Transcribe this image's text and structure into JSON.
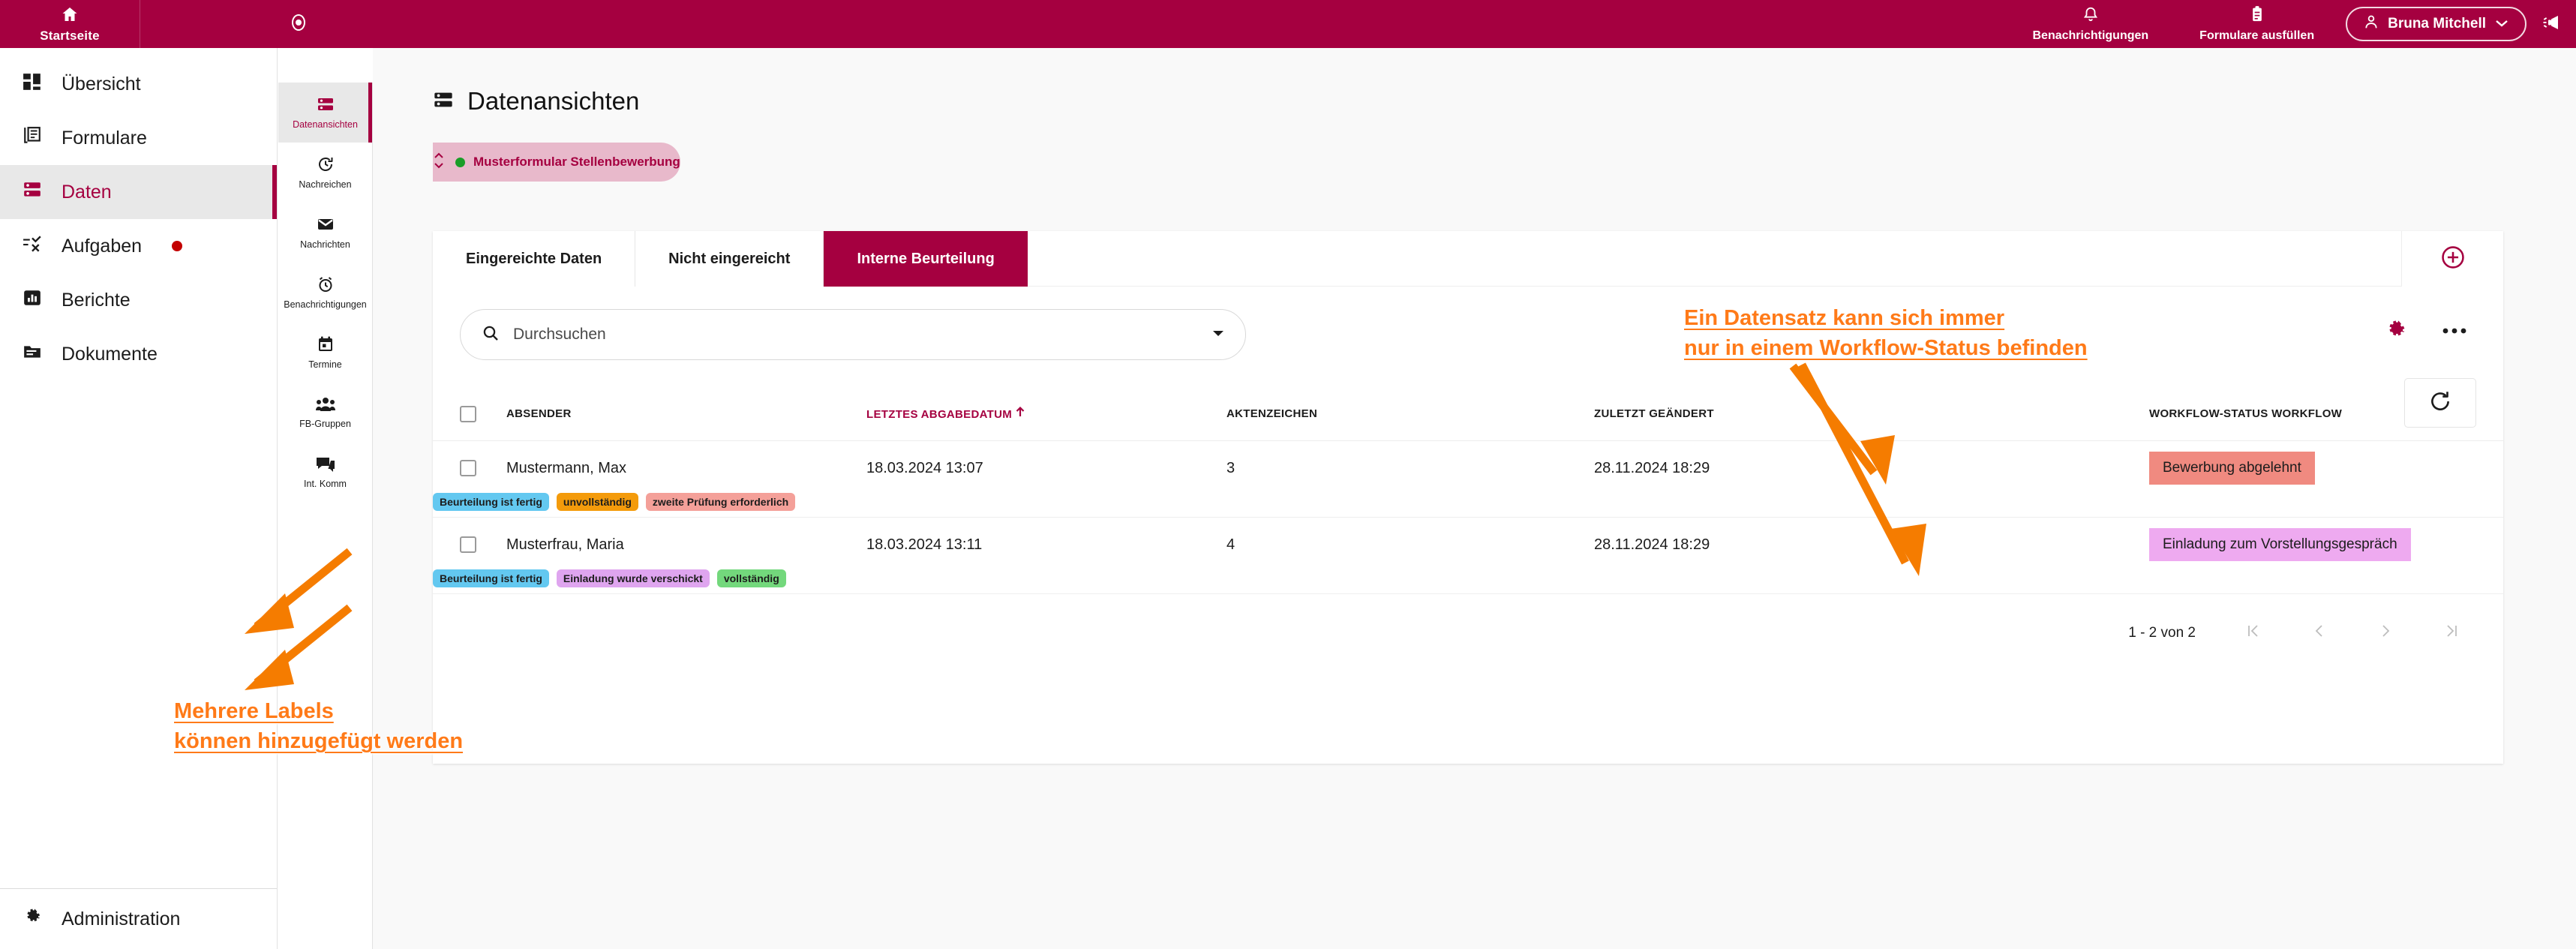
{
  "colors": {
    "brand": "#a50040",
    "brand_light": "#e8b9cb",
    "annotation": "#ff7a18",
    "active_bg": "#e8e8e8",
    "alert_dot": "#c30000",
    "status_green": "#1a9d28"
  },
  "topbar": {
    "home_label": "Startseite",
    "home_icon": "home-icon",
    "record_icon": "record-circle-icon",
    "notifications_label": "Benachrichtigungen",
    "notifications_icon": "bell-icon",
    "forms_label": "Formulare ausfüllen",
    "forms_icon": "clipboard-icon",
    "user_name": "Bruna Mitchell",
    "user_icon": "person-icon",
    "user_caret": "chevron-down-icon",
    "megaphone_icon": "megaphone-icon"
  },
  "sidebar": {
    "items": [
      {
        "label": "Übersicht",
        "icon": "dashboard-icon",
        "active": false,
        "dot": false
      },
      {
        "label": "Formulare",
        "icon": "forms-icon",
        "active": false,
        "dot": false
      },
      {
        "label": "Daten",
        "icon": "database-icon",
        "active": true,
        "dot": false
      },
      {
        "label": "Aufgaben",
        "icon": "tasks-icon",
        "active": false,
        "dot": true
      },
      {
        "label": "Berichte",
        "icon": "chart-icon",
        "active": false,
        "dot": false
      },
      {
        "label": "Dokumente",
        "icon": "folder-icon",
        "active": false,
        "dot": false
      }
    ],
    "bottom": {
      "label": "Administration",
      "icon": "gear-icon"
    }
  },
  "rail": {
    "items": [
      {
        "label": "Datenansichten",
        "icon": "database-icon",
        "active": true
      },
      {
        "label": "Nachreichen",
        "icon": "history-icon",
        "active": false
      },
      {
        "label": "Nachrichten",
        "icon": "mail-icon",
        "active": false
      },
      {
        "label": "Benachrichtigungen",
        "icon": "alarm-icon",
        "active": false
      },
      {
        "label": "Termine",
        "icon": "calendar-icon",
        "active": false
      },
      {
        "label": "FB-Gruppen",
        "icon": "people-icon",
        "active": false
      },
      {
        "label": "Int. Komm",
        "icon": "chat-icon",
        "active": false
      }
    ]
  },
  "page": {
    "title": "Datenansichten",
    "title_icon": "database-icon",
    "form_selector": {
      "name": "Musterformular Stellenbewerbung",
      "status_dot_color": "#1a9d28",
      "stepper_icon": "up-down-chevrons-icon"
    }
  },
  "tabs": [
    {
      "label": "Eingereichte Daten",
      "active": false
    },
    {
      "label": "Nicht eingereicht",
      "active": false
    },
    {
      "label": "Interne Beurteilung",
      "active": true
    }
  ],
  "toolbar": {
    "add_icon": "plus-circle-icon",
    "search_placeholder": "Durchsuchen",
    "search_value": "",
    "search_icon": "search-icon",
    "search_caret": "chevron-down-icon",
    "settings_icon": "gear-icon",
    "more_icon": "more-horizontal-icon",
    "refresh_icon": "refresh-icon"
  },
  "table": {
    "select_all_checked": false,
    "columns": [
      {
        "key": "absender",
        "label": "ABSENDER",
        "sorted": false
      },
      {
        "key": "datum",
        "label": "LETZTES ABGABEDATUM",
        "sorted": true,
        "sort_dir": "asc"
      },
      {
        "key": "akten",
        "label": "AKTENZEICHEN",
        "sorted": false
      },
      {
        "key": "geaendert",
        "label": "ZULETZT GEÄNDERT",
        "sorted": false
      },
      {
        "key": "workflow",
        "label": "WORKFLOW-STATUS WORKFLOW",
        "sorted": false
      }
    ],
    "rows": [
      {
        "checked": false,
        "absender": "Mustermann, Max",
        "datum": "18.03.2024 13:07",
        "akten": "3",
        "geaendert": "28.11.2024 18:29",
        "workflow": {
          "text": "Bewerbung abgelehnt",
          "color": "#f08a80"
        },
        "labels": [
          {
            "text": "Beurteilung ist fertig",
            "color": "#63c8f0"
          },
          {
            "text": "unvollständig",
            "color": "#f49b0b"
          },
          {
            "text": "zweite Prüfung erforderlich",
            "color": "#f4a099"
          }
        ]
      },
      {
        "checked": false,
        "absender": "Musterfrau, Maria",
        "datum": "18.03.2024 13:11",
        "akten": "4",
        "geaendert": "28.11.2024 18:29",
        "workflow": {
          "text": "Einladung zum Vorstellungsgespräch",
          "color": "#eeaaf0"
        },
        "labels": [
          {
            "text": "Beurteilung ist fertig",
            "color": "#63c8f0"
          },
          {
            "text": "Einladung wurde verschickt",
            "color": "#dfa5ef"
          },
          {
            "text": "vollständig",
            "color": "#73d87c"
          }
        ]
      }
    ]
  },
  "pagination": {
    "range_label": "1 - 2 von 2",
    "first_icon": "first-page-icon",
    "prev_icon": "prev-page-icon",
    "next_icon": "next-page-icon",
    "last_icon": "last-page-icon"
  },
  "annotations": {
    "workflow_note": "Ein Datensatz kann sich immer\nnur in einem Workflow-Status befinden",
    "labels_note": "Mehrere Labels\nkönnen hinzugefügt werden"
  }
}
